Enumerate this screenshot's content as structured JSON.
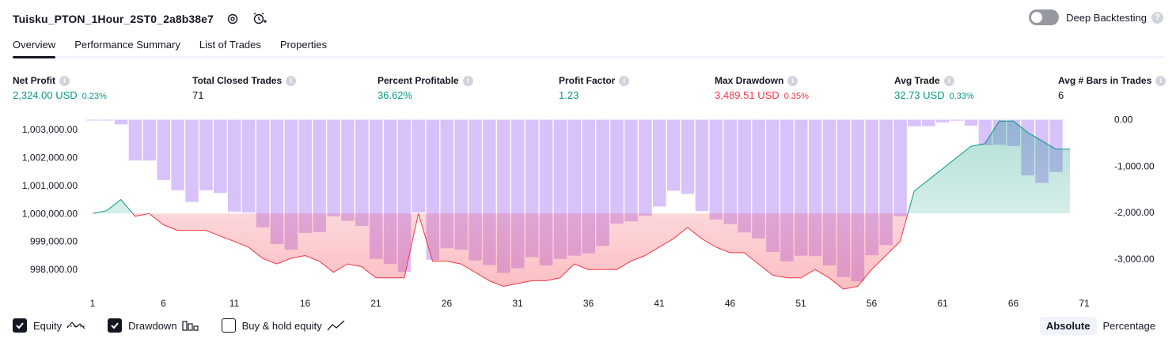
{
  "header": {
    "title": "Tuisku_PTON_1Hour_2ST0_2a8b38e7",
    "settings_icon": "gear-icon",
    "alert_icon": "add-alert-icon"
  },
  "deep_backtesting": {
    "label": "Deep Backtesting",
    "enabled": false,
    "help": "?"
  },
  "tabs": [
    {
      "label": "Overview",
      "active": true
    },
    {
      "label": "Performance Summary",
      "active": false
    },
    {
      "label": "List of Trades",
      "active": false
    },
    {
      "label": "Properties",
      "active": false
    }
  ],
  "metrics": [
    {
      "label": "Net Profit",
      "value": "2,324.00 USD",
      "pct": "0.23%",
      "color": "green"
    },
    {
      "label": "Total Closed Trades",
      "value": "71",
      "pct": "",
      "color": "dark"
    },
    {
      "label": "Percent Profitable",
      "value": "36.62%",
      "pct": "",
      "color": "green"
    },
    {
      "label": "Profit Factor",
      "value": "1.23",
      "pct": "",
      "color": "green"
    },
    {
      "label": "Max Drawdown",
      "value": "3,489.51 USD",
      "pct": "0.35%",
      "color": "red"
    },
    {
      "label": "Avg Trade",
      "value": "32.73 USD",
      "pct": "0.33%",
      "color": "green"
    },
    {
      "label": "Avg # Bars in Trades",
      "value": "6",
      "pct": "",
      "color": "dark"
    }
  ],
  "info_icon_text": "i",
  "chart_data": {
    "type": "line",
    "x_ticks": [
      "1",
      "6",
      "11",
      "16",
      "21",
      "26",
      "31",
      "36",
      "41",
      "46",
      "51",
      "56",
      "61",
      "66",
      "71"
    ],
    "left_axis": {
      "ticks": [
        "1,003,000.00",
        "1,002,000.00",
        "1,001,000.00",
        "1,000,000.00",
        "999,000.00",
        "998,000.00"
      ],
      "values": [
        1003000,
        1002000,
        1001000,
        1000000,
        999000,
        998000
      ],
      "ylim": [
        997300,
        1003450
      ]
    },
    "right_axis": {
      "ticks": [
        "0.00",
        "-1,000.00",
        "-2,000.00",
        "-3,000.00"
      ],
      "values": [
        0,
        -1000,
        -2000,
        -3000
      ],
      "ylim": [
        -3650,
        60
      ]
    },
    "baseline": 1000000,
    "series": [
      {
        "name": "Equity",
        "color_up": "#089981",
        "color_down": "#f23645",
        "values": [
          1000000,
          1000100,
          1000500,
          999900,
          1000000,
          999600,
          999400,
          999400,
          999400,
          999200,
          999000,
          998800,
          998400,
          998200,
          998400,
          998500,
          998300,
          997900,
          998200,
          998100,
          997700,
          997700,
          997700,
          1000000,
          998300,
          998300,
          998200,
          997900,
          997600,
          997400,
          997500,
          997600,
          997600,
          997700,
          998200,
          998000,
          998000,
          998000,
          998300,
          998500,
          998800,
          999100,
          999500,
          999100,
          998800,
          998600,
          998600,
          998200,
          997800,
          997700,
          997700,
          998000,
          997700,
          997300,
          997400,
          998000,
          998500,
          999000,
          1000800,
          1001200,
          1001600,
          1002000,
          1002400,
          1002500,
          1003300,
          1003300,
          1002900,
          1002600,
          1002300,
          1002300
        ]
      },
      {
        "name": "Drawdown",
        "color": "#d1b3f9",
        "values": [
          0,
          0,
          -100,
          -880,
          -880,
          -1300,
          -1520,
          -1770,
          -1520,
          -1580,
          -1980,
          -2000,
          -2320,
          -2680,
          -2800,
          -2440,
          -2420,
          -2080,
          -2180,
          -2290,
          -3000,
          -3110,
          -3280,
          -2000,
          -3020,
          -2770,
          -2800,
          -3030,
          -3130,
          -3300,
          -3200,
          -2960,
          -3140,
          -3000,
          -2930,
          -2880,
          -2720,
          -2240,
          -2190,
          -2070,
          -1870,
          -1530,
          -1600,
          -1970,
          -2150,
          -2250,
          -2430,
          -2560,
          -2850,
          -3050,
          -2930,
          -2940,
          -3140,
          -3390,
          -3480,
          -2920,
          -2700,
          -2080,
          -140,
          -140,
          -60,
          -20,
          -130,
          -550,
          -540,
          -570,
          -1200,
          -1360,
          -1130
        ]
      },
      {
        "name": "Buy & hold equity",
        "values": []
      }
    ]
  },
  "legend": [
    {
      "label": "Equity",
      "checked": true,
      "icon": "equity-line-icon"
    },
    {
      "label": "Drawdown",
      "checked": true,
      "icon": "drawdown-bars-icon"
    },
    {
      "label": "Buy & hold equity",
      "checked": false,
      "icon": "buy-hold-line-icon"
    }
  ],
  "scale_modes": [
    {
      "label": "Absolute",
      "active": true
    },
    {
      "label": "Percentage",
      "active": false
    }
  ]
}
